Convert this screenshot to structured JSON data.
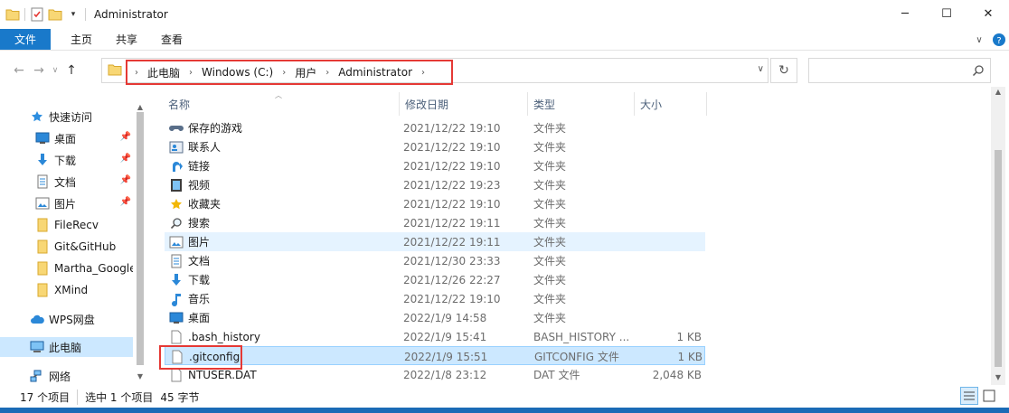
{
  "window": {
    "title": "Administrator",
    "controls": {
      "minimize": "─",
      "maximize": "☐",
      "close": "✕"
    }
  },
  "ribbon": {
    "tabs": [
      "文件",
      "主页",
      "共享",
      "查看"
    ]
  },
  "address": {
    "crumbs": [
      "此电脑",
      "Windows (C:)",
      "用户",
      "Administrator"
    ],
    "search_placeholder": ""
  },
  "nav": {
    "items": [
      {
        "label": "快速访问",
        "icon": "star-icon",
        "pinned": false
      },
      {
        "label": "桌面",
        "icon": "desktop-icon",
        "pinned": true
      },
      {
        "label": "下载",
        "icon": "download-icon",
        "pinned": true
      },
      {
        "label": "文档",
        "icon": "document-icon",
        "pinned": true
      },
      {
        "label": "图片",
        "icon": "picture-icon",
        "pinned": true
      },
      {
        "label": "FileRecv",
        "icon": "folder-icon",
        "pinned": false
      },
      {
        "label": "Git&GitHub",
        "icon": "folder-icon",
        "pinned": false
      },
      {
        "label": "Martha_Google",
        "icon": "folder-icon",
        "pinned": false
      },
      {
        "label": "XMind",
        "icon": "folder-icon",
        "pinned": false
      },
      {
        "label": "WPS网盘",
        "icon": "cloud-icon",
        "pinned": false
      },
      {
        "label": "此电脑",
        "icon": "computer-icon",
        "pinned": false,
        "selected": true
      },
      {
        "label": "网络",
        "icon": "network-icon",
        "pinned": false
      }
    ]
  },
  "columns": {
    "name": "名称",
    "date": "修改日期",
    "type": "类型",
    "size": "大小"
  },
  "files": [
    {
      "name": "保存的游戏",
      "date": "2021/12/22 19:10",
      "type": "文件夹",
      "size": "",
      "icon": "saved-games-icon"
    },
    {
      "name": "联系人",
      "date": "2021/12/22 19:10",
      "type": "文件夹",
      "size": "",
      "icon": "contacts-icon"
    },
    {
      "name": "链接",
      "date": "2021/12/22 19:10",
      "type": "文件夹",
      "size": "",
      "icon": "links-icon"
    },
    {
      "name": "视频",
      "date": "2021/12/22 19:23",
      "type": "文件夹",
      "size": "",
      "icon": "video-icon"
    },
    {
      "name": "收藏夹",
      "date": "2021/12/22 19:10",
      "type": "文件夹",
      "size": "",
      "icon": "favorites-icon"
    },
    {
      "name": "搜索",
      "date": "2021/12/22 19:11",
      "type": "文件夹",
      "size": "",
      "icon": "searches-icon"
    },
    {
      "name": "图片",
      "date": "2021/12/22 19:11",
      "type": "文件夹",
      "size": "",
      "icon": "picture-icon",
      "state": "hover"
    },
    {
      "name": "文档",
      "date": "2021/12/30 23:33",
      "type": "文件夹",
      "size": "",
      "icon": "document-icon"
    },
    {
      "name": "下载",
      "date": "2021/12/26 22:27",
      "type": "文件夹",
      "size": "",
      "icon": "download-icon"
    },
    {
      "name": "音乐",
      "date": "2021/12/22 19:10",
      "type": "文件夹",
      "size": "",
      "icon": "music-icon"
    },
    {
      "name": "桌面",
      "date": "2022/1/9 14:58",
      "type": "文件夹",
      "size": "",
      "icon": "desktop-icon"
    },
    {
      "name": ".bash_history",
      "date": "2022/1/9 15:41",
      "type": "BASH_HISTORY ...",
      "size": "1 KB",
      "icon": "file-icon"
    },
    {
      "name": ".gitconfig",
      "date": "2022/1/9 15:51",
      "type": "GITCONFIG 文件",
      "size": "1 KB",
      "icon": "file-icon",
      "state": "selected"
    },
    {
      "name": "NTUSER.DAT",
      "date": "2022/1/8 23:12",
      "type": "DAT 文件",
      "size": "2,048 KB",
      "icon": "file-icon"
    }
  ],
  "status": {
    "count": "17 个项目",
    "selection": "选中 1 个项目",
    "size": "45 字节"
  },
  "colors": {
    "accent": "#1979ca",
    "selected": "#cce8ff",
    "hover": "#e5f3ff",
    "highlight_box": "#e53935"
  }
}
